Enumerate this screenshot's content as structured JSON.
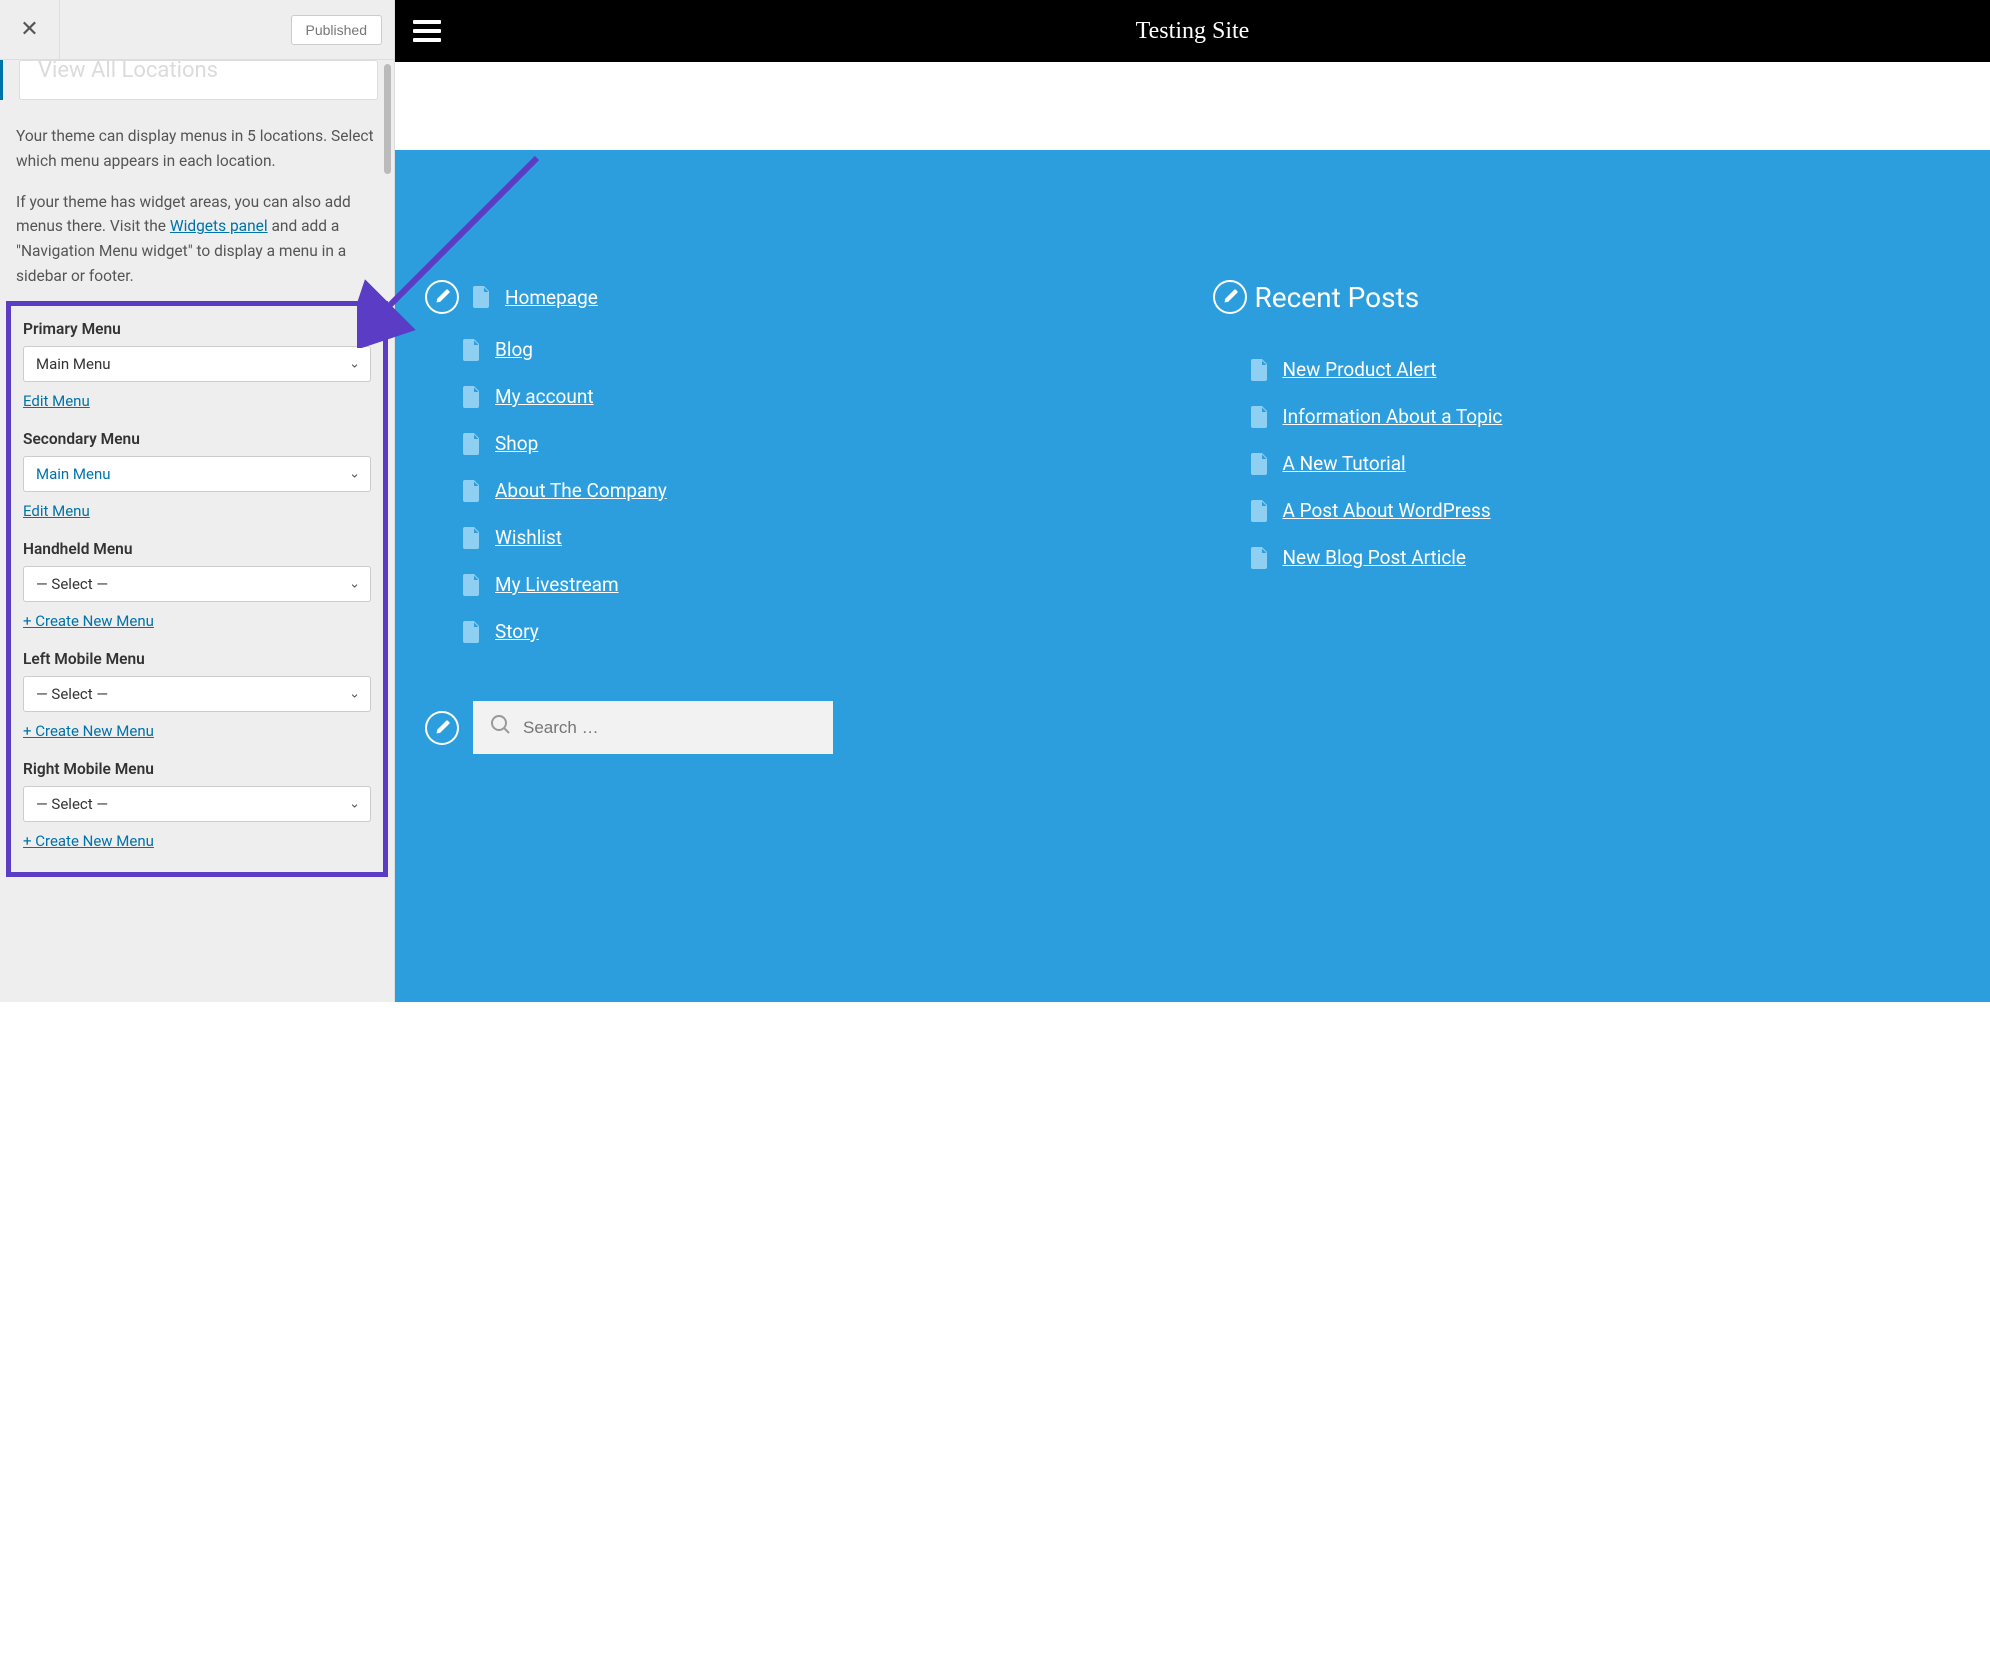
{
  "sidebar": {
    "published_label": "Published",
    "truncated_row": "View All Locations",
    "info1": "Your theme can display menus in 5 locations. Select which menu appears in each location.",
    "info2_pre": "If your theme has widget areas, you can also add menus there. Visit the ",
    "info2_link": "Widgets panel",
    "info2_post": " and add a \"Navigation Menu widget\" to display a menu in a sidebar or footer.",
    "locations": [
      {
        "label": "Primary Menu",
        "value": "Main Menu",
        "value_blue": false,
        "action": "Edit Menu"
      },
      {
        "label": "Secondary Menu",
        "value": "Main Menu",
        "value_blue": true,
        "action": "Edit Menu"
      },
      {
        "label": "Handheld Menu",
        "value": "— Select —",
        "value_blue": false,
        "action": "+ Create New Menu"
      },
      {
        "label": "Left Mobile Menu",
        "value": "— Select —",
        "value_blue": false,
        "action": "+ Create New Menu"
      },
      {
        "label": "Right Mobile Menu",
        "value": "— Select —",
        "value_blue": false,
        "action": "+ Create New Menu"
      }
    ]
  },
  "preview": {
    "site_title": "Testing Site",
    "recent_posts_heading": "Recent Posts",
    "nav_links": [
      "Homepage",
      "Blog",
      "My account",
      "Shop",
      "About The Company",
      "Wishlist",
      "My Livestream",
      "Story"
    ],
    "recent_posts": [
      "New Product Alert",
      "Information About a Topic",
      "A New Tutorial",
      "A Post About WordPress",
      "New Blog Post Article"
    ],
    "search_placeholder": "Search …"
  }
}
